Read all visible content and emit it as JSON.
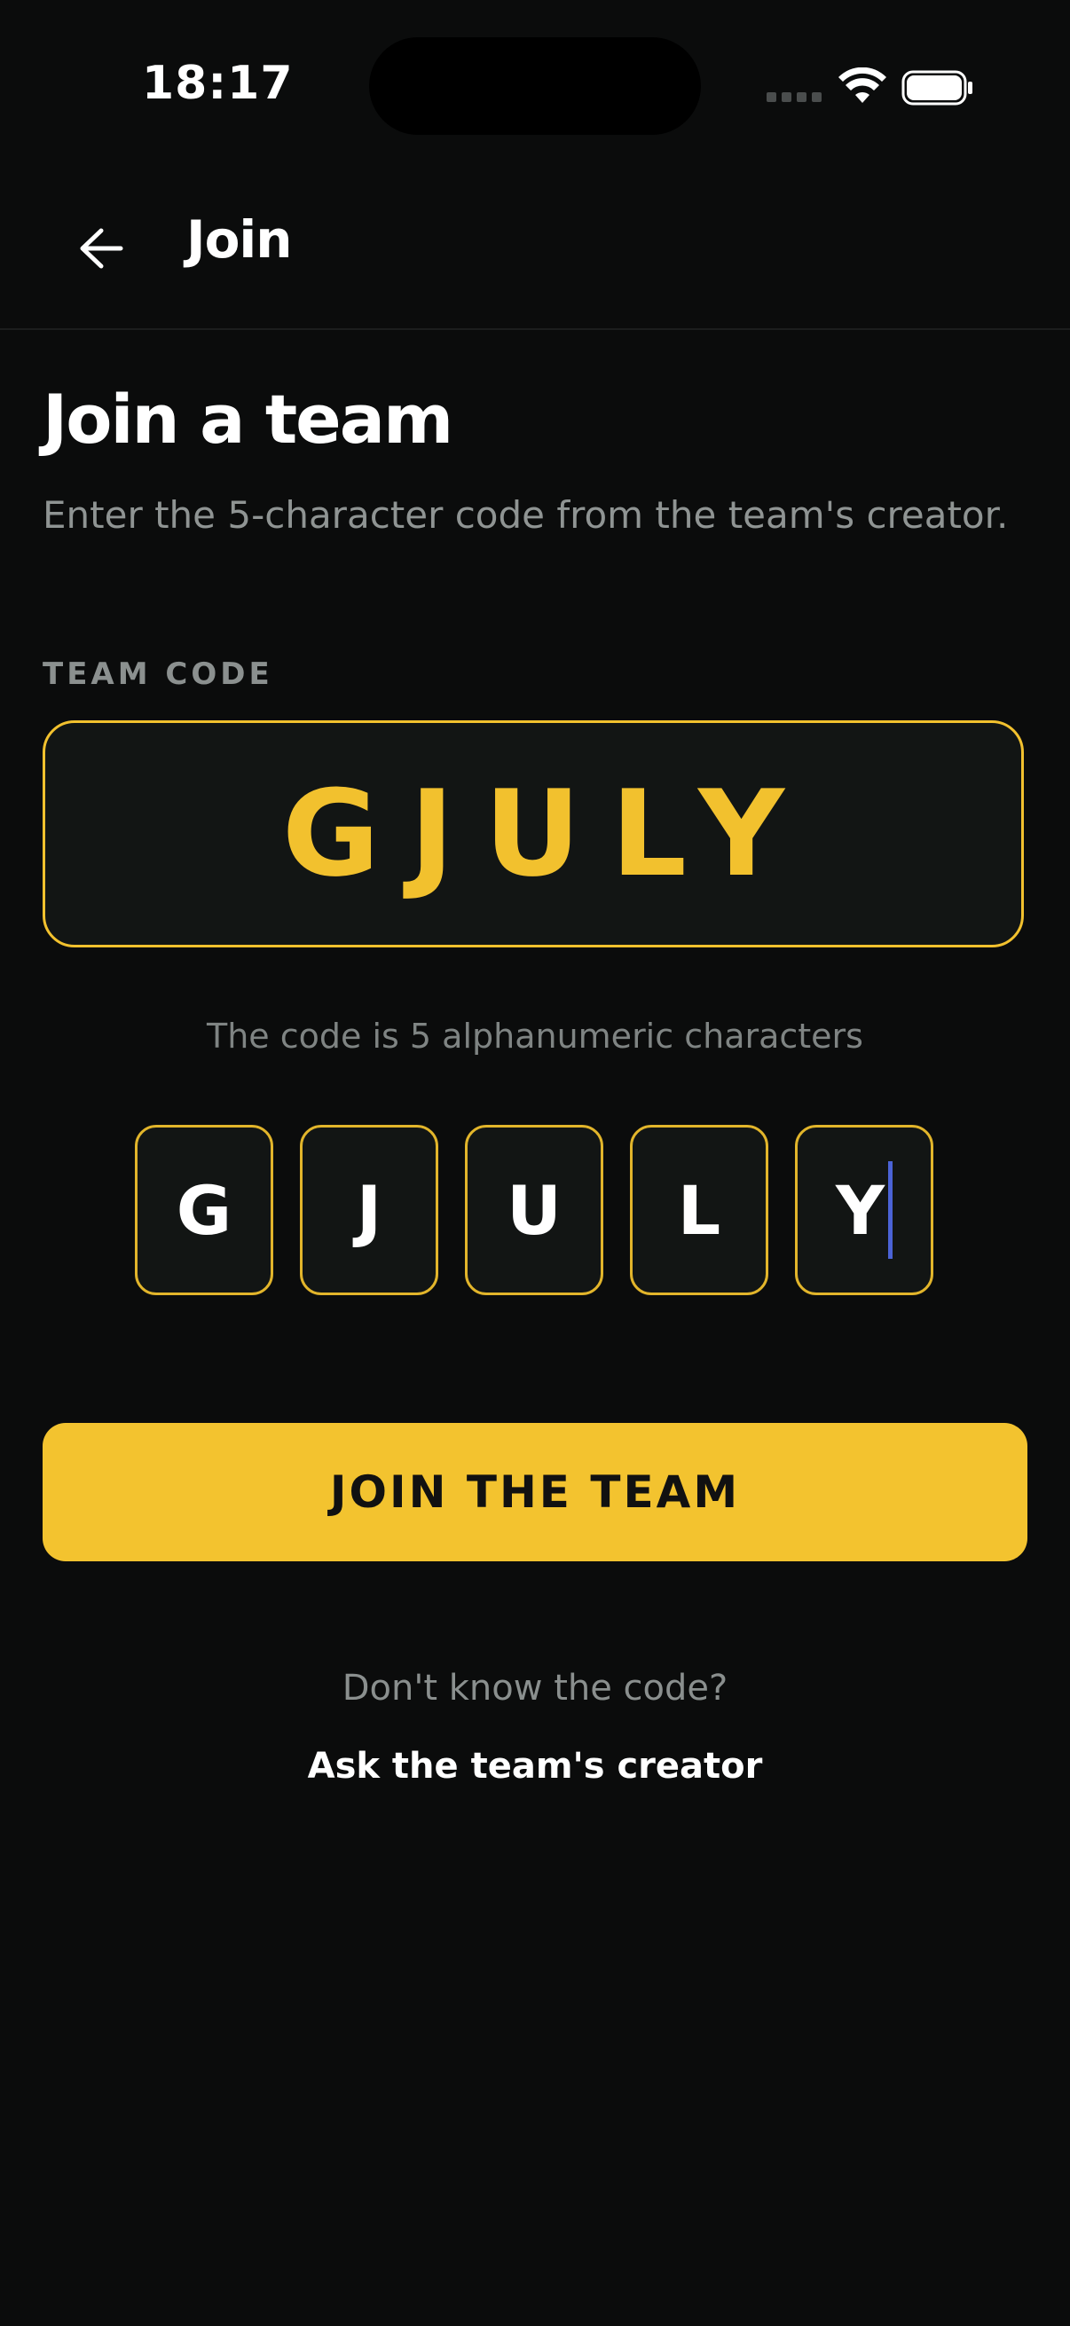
{
  "status_bar": {
    "time": "18:17",
    "icons": [
      "signal-icon",
      "wifi-icon",
      "battery-icon"
    ]
  },
  "header": {
    "back_icon": "arrow-left-icon",
    "title": "Join"
  },
  "main": {
    "title": "Join a team",
    "subtitle": "Enter the 5-character code from the team's creator.",
    "field_label": "TEAM CODE",
    "code_value": "GJULY",
    "hint": "The code is 5 alphanumeric characters",
    "characters": [
      "G",
      "J",
      "U",
      "L",
      "Y"
    ],
    "join_button_label": "JOIN THE TEAM",
    "footer_question": "Don't know the code?",
    "footer_link": "Ask the team's creator"
  },
  "colors": {
    "background": "#0b0c0c",
    "accent": "#f3c32f",
    "caret": "#4b63d6"
  }
}
